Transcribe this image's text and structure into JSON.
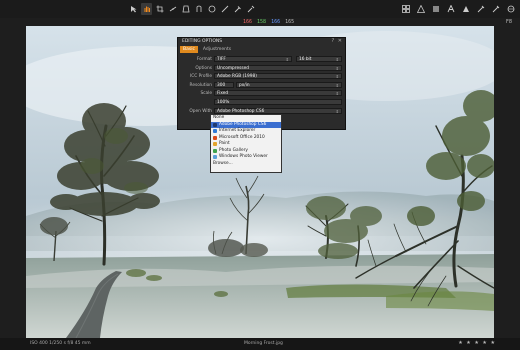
{
  "toolbar": {
    "tools": [
      "select-icon",
      "hand-icon",
      "crop-icon",
      "straighten-icon",
      "keystone-icon",
      "spot-icon",
      "circle-icon",
      "brush-icon",
      "picker-icon",
      "eyedropper-icon"
    ],
    "active_tool": 1
  },
  "rgb_readout": {
    "r": "166",
    "g": "158",
    "b": "166",
    "a": "165"
  },
  "status_right": "F8",
  "dialog": {
    "title": "EDITING OPTIONS",
    "tabs": [
      "Basic",
      "Adjustments"
    ],
    "rows": [
      {
        "label": "Format",
        "value": "TIFF",
        "extra": "16 bit"
      },
      {
        "label": "Options",
        "value": "Uncompressed"
      },
      {
        "label": "ICC Profile",
        "value": "Adobe RGB (1998)"
      },
      {
        "label": "Resolution",
        "value": "300",
        "extra": "px/in"
      },
      {
        "label": "Scale",
        "value": "Fixed"
      },
      {
        "label": "",
        "value": "100%"
      },
      {
        "label": "Open With",
        "value": "Adobe Photoshop CS6"
      }
    ]
  },
  "dropdown": {
    "options": [
      {
        "label": "None",
        "color": ""
      },
      {
        "label": "Adobe Photoshop CS6",
        "color": "#1f3a70"
      },
      {
        "label": "Internet Explorer",
        "color": "#2f7ad6"
      },
      {
        "label": "Microsoft Office 2010",
        "color": "#d84a1b"
      },
      {
        "label": "Paint",
        "color": "#e4a52c"
      },
      {
        "label": "Photo Gallery",
        "color": "#3fa34d"
      },
      {
        "label": "Windows Photo Viewer",
        "color": "#5aa0d8"
      },
      {
        "label": "Browse...",
        "color": ""
      }
    ],
    "selected": 1
  },
  "bottom": {
    "info": "ISO 400  1/250 s  f/8  45 mm",
    "filename": "Morning Frost.jpg",
    "rating": "★ ★ ★ ★ ★"
  }
}
